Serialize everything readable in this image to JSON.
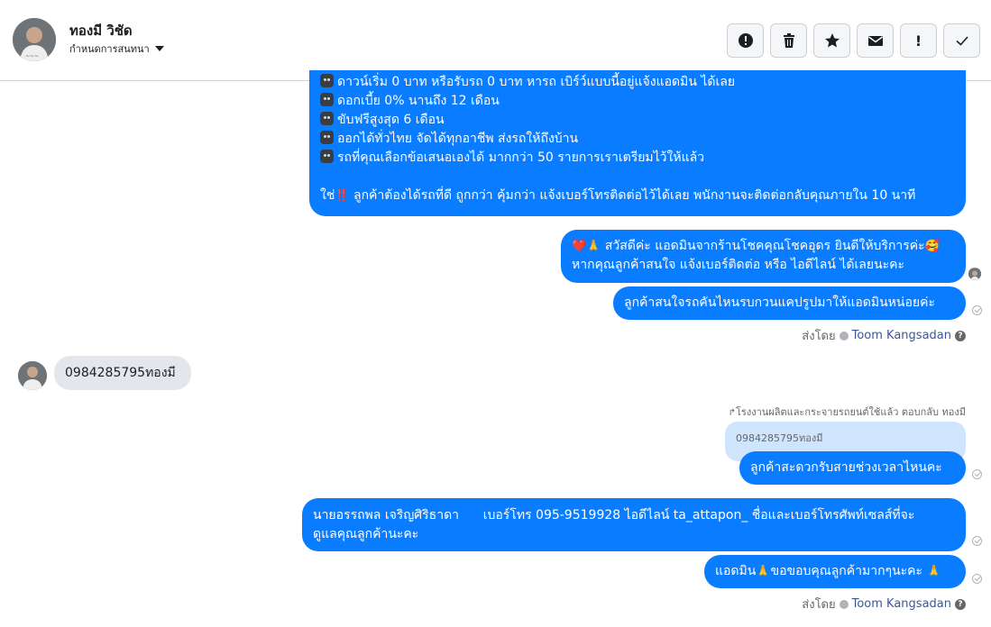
{
  "header": {
    "contact_name": "ทองมี วิชัด",
    "subtitle": "กำหนดการสนทนา",
    "toolbar": [
      {
        "name": "alert-circle-button",
        "icon": "alert-circle-icon"
      },
      {
        "name": "delete-button",
        "icon": "trash-icon"
      },
      {
        "name": "star-button",
        "icon": "star-icon"
      },
      {
        "name": "mail-button",
        "icon": "envelope-icon"
      },
      {
        "name": "important-button",
        "icon": "exclamation-icon",
        "label": "!"
      },
      {
        "name": "done-button",
        "icon": "checkmark-icon"
      }
    ]
  },
  "messages": {
    "promo_lines": [
      "ดาวน์เริ่ม 0 บาท หรือรับรถ 0 บาท หารถ เบิร์ว์แบบนี้อยู่แจ้งแอดมิน ได้เลย",
      "ดอกเบี้ย 0% นานถึง 12 เดือน",
      "ขับฟรีสูงสุด 6 เดือน",
      "ออกได้ทั่วไทย จัดได้ทุกอาชีพ ส่งรถให้ถึงบ้าน",
      "รถที่คุณเลือกข้อเสนอเองได้ มากกว่า 50 รายการเราเตรียมไว้ให้แล้ว"
    ],
    "promo_prefix": "ใช่",
    "promo_exclaim": "‼️",
    "promo_cta": "ลูกค้าต้องได้รถที่ดี ถูกกว่า คุ้มกว่า แจ้งเบอร์โทรติดต่อไว้ได้เลย พนักงานจะติดต่อกลับคุณภายใน 10 นาที",
    "greeting_heart": "❤️",
    "greeting_pray": "🙏",
    "greeting_line1": "สวัสดีค่ะ แอดมินจากร้านโชคคุณโชคอุดร ยินดีให้บริการค่ะ",
    "greeting_smile": "🥰",
    "greeting_line2": "หากคุณลูกค้าสนใจ แจ้งเบอร์ติดต่อ หรือ ไอดีไลน์ ได้เลยนะคะ",
    "ask_model": "ลูกค้าสนใจรถคันไหนรบกวนแคปรูปมาให้แอดมินหน่อยค่ะ",
    "sent_by_label": "ส่งโดย",
    "sent_by_name": "Toom Kangsadan",
    "help_glyph": "?",
    "customer_phone": "0984285795ทองมี",
    "reply_note": "โรงงานผลิตและกระจายรถยนต์ใช้แล้ว ตอบกลับ ทองมี",
    "quoted_text": "0984285795ทองมี",
    "ask_time": "ลูกค้าสะดวกรับสายช่วงเวลาไหนคะ",
    "contact_line1": "นายอรรถพล เจริญศิริธาดา      เบอร์โทร 095-9519928 ไอดีไลน์ ta_attapon_ ชื่อและเบอร์โทรศัพท์เซลส์ที่จะ",
    "contact_line2": "ดูแลคุณลูกค้านะคะ",
    "thanks_prefix": "แอดมิน",
    "thanks_pray": "🙏",
    "thanks_text": "ขอขอบคุณลูกค้ามากๆนะคะ ",
    "thanks_pray2": "🙏"
  },
  "colors": {
    "outgoing_bubble": "#0a7cff",
    "incoming_bubble": "#e4e6eb",
    "quoted_bubble": "#cfe4fd",
    "sender_link": "#385898"
  }
}
